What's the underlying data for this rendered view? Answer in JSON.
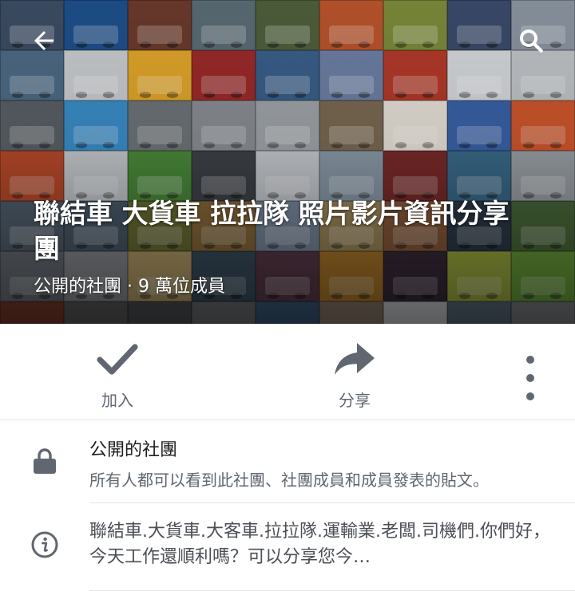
{
  "colors": {
    "icon_gray": "#606770",
    "text_primary": "#1c1e21",
    "text_secondary": "#606770",
    "divider": "#e3e4e8"
  },
  "header": {
    "back_icon": "back-arrow-icon",
    "search_icon": "search-icon",
    "cover_tiles": [
      "#3b4c63",
      "#1e4f8a",
      "#6a3a2c",
      "#5a6b74",
      "#4e5f3c",
      "#b8542c",
      "#7a8a3a",
      "#3a4a6a",
      "#8a94a0",
      "#4d6a84",
      "#c9ccd0",
      "#e0a62a",
      "#9c2a2a",
      "#3a5f8a",
      "#6c7fa4",
      "#b33a2a",
      "#d5d8dc",
      "#c0c4c8",
      "#5a6066",
      "#3a8ec9",
      "#6e7478",
      "#8a8f94",
      "#a0a5aa",
      "#7a6a52",
      "#e8e2d8",
      "#3a62a8",
      "#d0572c",
      "#b84a2a",
      "#c5c9cd",
      "#4a8a3a",
      "#3e4248",
      "#c6cacf",
      "#8a9aa8",
      "#7a2a2a",
      "#3a6a8a",
      "#9aa0a6",
      "#52606e",
      "#4a5a6a",
      "#6a6e32",
      "#8a6a3a",
      "#7a8aa0",
      "#a08a5a",
      "#8a5a3a",
      "#2c3a4a",
      "#4a6a3a",
      "#6a7078",
      "#8a8e92",
      "#b8a06a",
      "#3a4e5e",
      "#5a3a4a",
      "#b07a2a",
      "#3a2a3a",
      "#a0b040",
      "#6aa03a",
      "#7a3a2a",
      "#5a5a5a",
      "#4a4e52",
      "#6a6e72",
      "#3a5a7a",
      "#8a7a6a",
      "#c8ccd0",
      "#5a6a7a",
      "#7a7e82"
    ],
    "group_name": "聯結車 大貨車 拉拉隊 照片影片資訊分享團",
    "group_meta": "公開的社團 · 9 萬位成員"
  },
  "actions": {
    "join": {
      "label": "加入",
      "icon": "checkmark-icon"
    },
    "share": {
      "label": "分享",
      "icon": "share-arrow-icon"
    },
    "more_icon": "more-vertical-icon"
  },
  "privacy": {
    "icon": "lock-icon",
    "title": "公開的社團",
    "description": "所有人都可以看到此社團、社團成員和成員發表的貼文。"
  },
  "about": {
    "icon": "info-icon",
    "text": "聯結車.大貨車.大客車.拉拉隊.運輸業.老闆.司機們.你們好，今天工作還順利嗎？可以分享您今…"
  }
}
